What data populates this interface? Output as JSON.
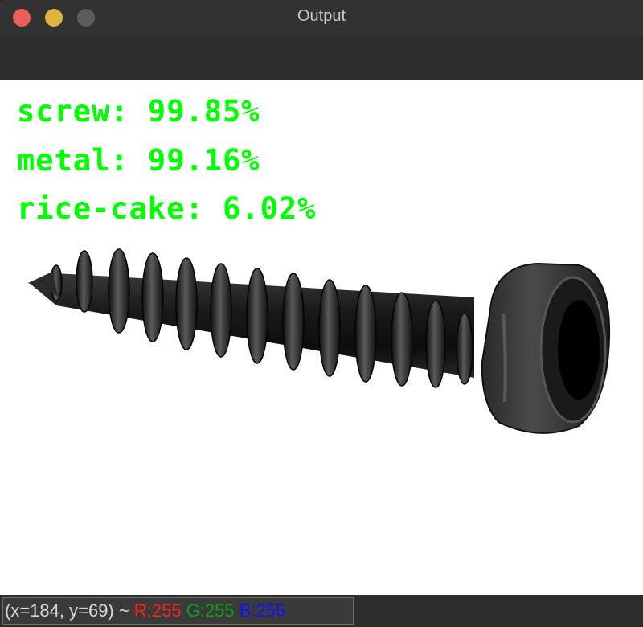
{
  "window": {
    "title": "Output"
  },
  "predictions": [
    {
      "text": "screw: 99.85%"
    },
    {
      "text": "metal: 99.16%"
    },
    {
      "text": "rice-cake: 6.02%"
    }
  ],
  "status": {
    "coords": "(x=184, y=69) ~",
    "r": "R:255",
    "g": "G:255",
    "b": "B:255"
  },
  "colors": {
    "label_green": "#00ff00",
    "r_red": "#ff2020",
    "g_green": "#0da00d",
    "b_blue": "#1010ff"
  }
}
